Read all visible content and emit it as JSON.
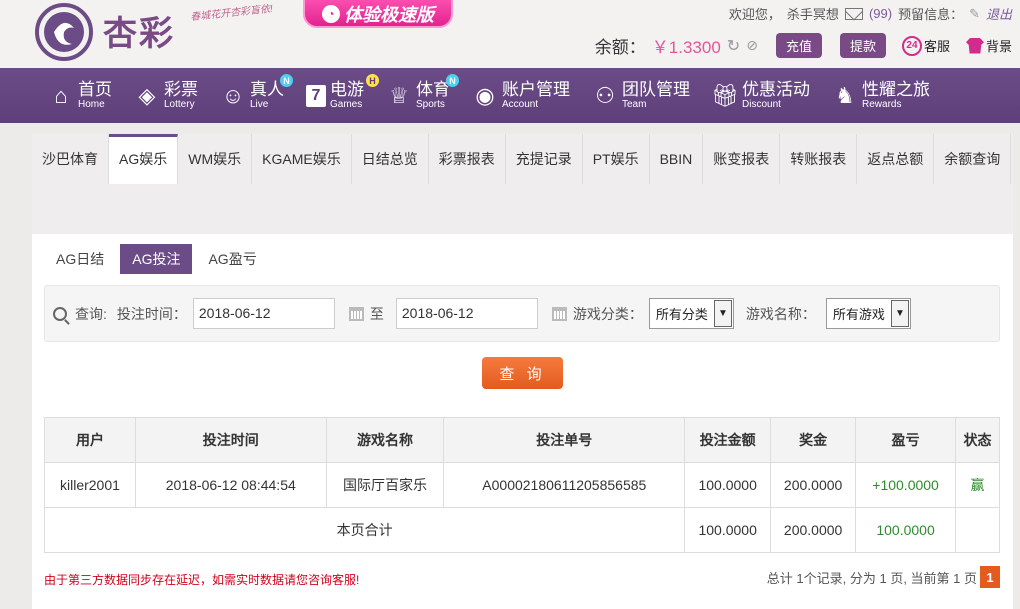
{
  "brand": {
    "name": "杏彩",
    "slogan": "春城花开杏彩盲依!"
  },
  "speed_button": "体验极速版",
  "top": {
    "welcome": "欢迎您，",
    "username": "杀手冥想",
    "mail_count": "(99)",
    "notice": "预留信息：",
    "logout": "退出"
  },
  "balance": {
    "label": "余额：",
    "value": "￥1.3300",
    "deposit": "充值",
    "withdraw": "提款",
    "service": "客服",
    "skin": "背景"
  },
  "nav": [
    {
      "cn": "首页",
      "en": "Home",
      "icon": "home-icon"
    },
    {
      "cn": "彩票",
      "en": "Lottery",
      "icon": "ticket-icon"
    },
    {
      "cn": "真人",
      "en": "Live",
      "icon": "live-icon",
      "badge": "N"
    },
    {
      "cn": "电游",
      "en": "Games",
      "icon": "seven-icon",
      "badge": "H"
    },
    {
      "cn": "体育",
      "en": "Sports",
      "icon": "trophy-icon",
      "badge": "N"
    },
    {
      "cn": "账户管理",
      "en": "Account",
      "icon": "account-icon"
    },
    {
      "cn": "团队管理",
      "en": "Team",
      "icon": "team-icon"
    },
    {
      "cn": "优惠活动",
      "en": "Discount",
      "icon": "gift-icon"
    },
    {
      "cn": "性耀之旅",
      "en": "Rewards",
      "icon": "rewards-icon"
    }
  ],
  "tabs": [
    "沙巴体育",
    "AG娱乐",
    "WM娱乐",
    "KGAME娱乐",
    "日结总览",
    "彩票报表",
    "充提记录",
    "PT娱乐",
    "BBIN",
    "账变报表",
    "转账报表",
    "返点总额",
    "余额查询"
  ],
  "subtabs": [
    "AG日结",
    "AG投注",
    "AG盈亏"
  ],
  "filter": {
    "query": "查询:",
    "bet_time": "投注时间：",
    "date_from": "2018-06-12",
    "to": "至",
    "date_to": "2018-06-12",
    "category_label": "游戏分类：",
    "category_value": "所有分类",
    "game_label": "游戏名称：",
    "game_value": "所有游戏"
  },
  "query_button": "查 询",
  "table": {
    "headers": [
      "用户",
      "投注时间",
      "游戏名称",
      "投注单号",
      "投注金额",
      "奖金",
      "盈亏",
      "状态"
    ],
    "rows": [
      [
        "killer2001",
        "2018-06-12 08:44:54",
        "国际厅百家乐",
        "A00002180611205856585",
        "100.0000",
        "200.0000",
        "+100.0000",
        "赢"
      ]
    ],
    "subtotal": {
      "label": "本页合计",
      "bet": "100.0000",
      "bonus": "200.0000",
      "profit": "100.0000"
    }
  },
  "note": "由于第三方数据同步存在延迟，如需实时数据请您咨询客服!",
  "pager": {
    "summary": "总计 1个记录, 分为 1 页, 当前第 1 页",
    "current": "1"
  },
  "colors": {
    "primary": "#6b4c86",
    "accent": "#e45b1d",
    "pink": "#e2579c",
    "green": "#2e8b2e"
  }
}
